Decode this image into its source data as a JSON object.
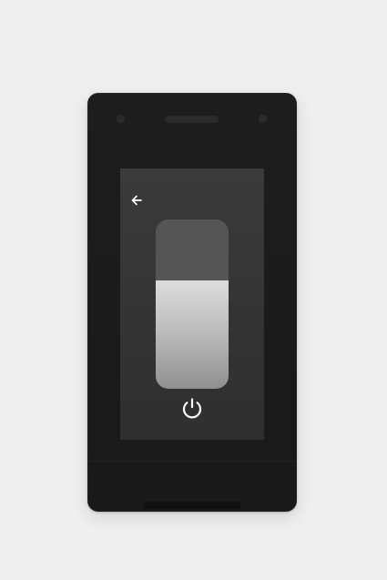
{
  "app": {
    "title": ""
  },
  "controls": {
    "back": {
      "icon": "back-arrow-icon"
    },
    "brightness_slider": {
      "level_percent": 64
    },
    "power": {
      "icon": "power-icon"
    }
  },
  "colors": {
    "device_body": "#1b1b1b",
    "screen_bg": "#353535",
    "slider_track": "#555555",
    "slider_fill_top": "#dcdcdc",
    "slider_fill_bottom": "#8f8f8f",
    "icon_color": "#ffffff"
  }
}
